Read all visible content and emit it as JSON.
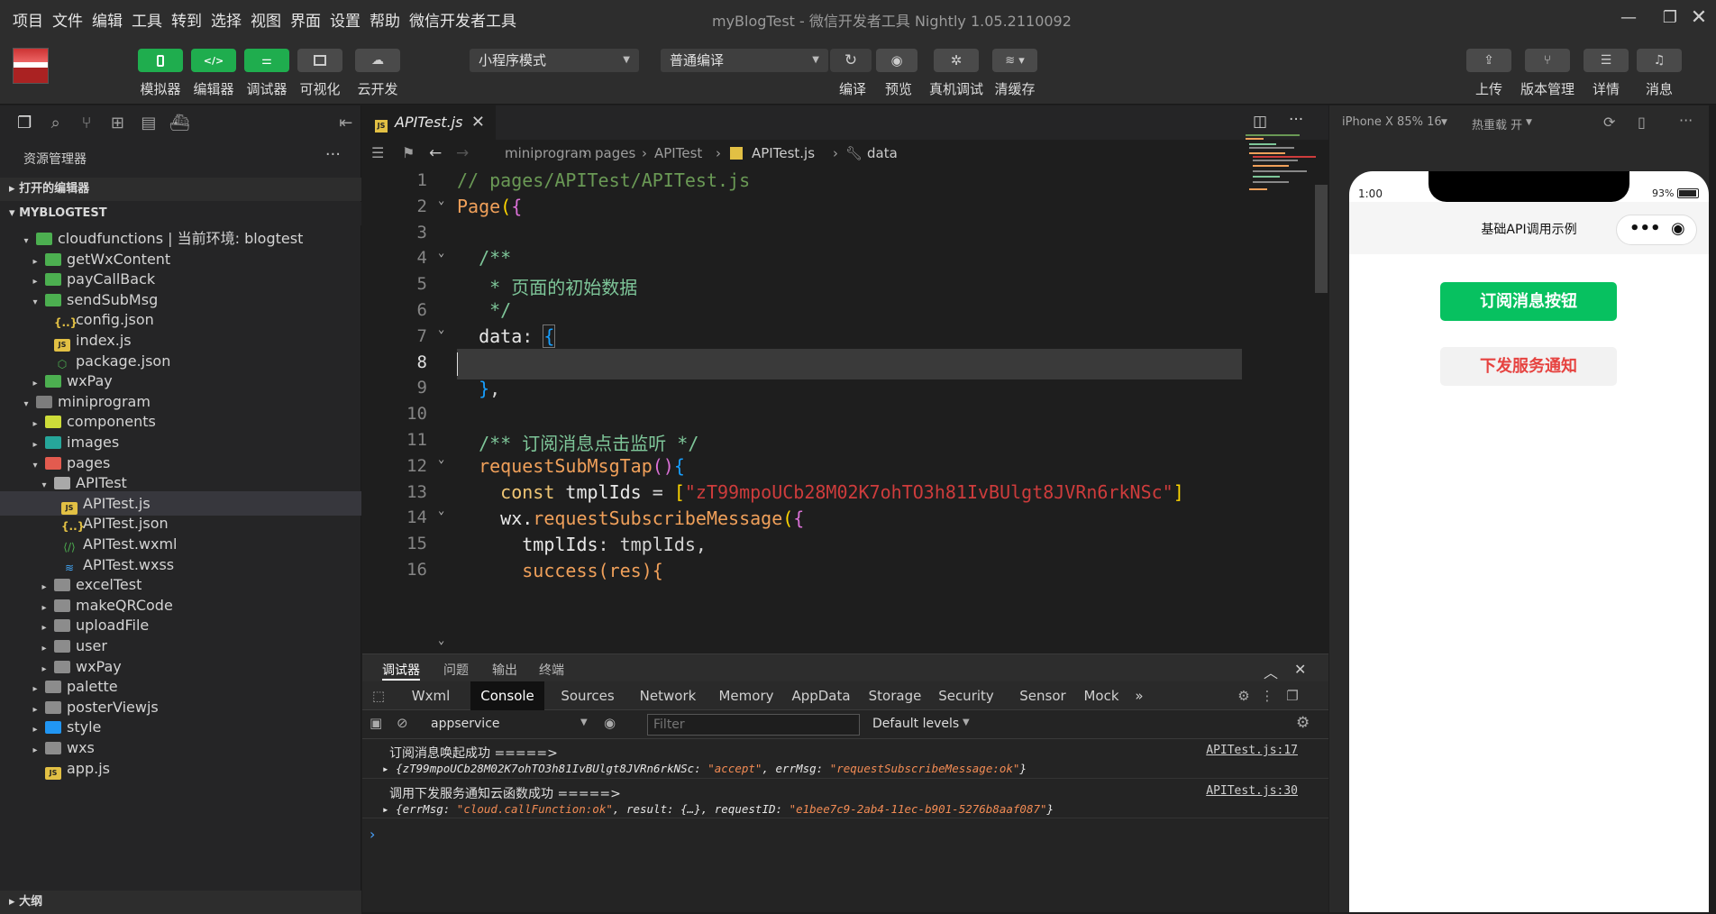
{
  "menu": [
    "项目",
    "文件",
    "编辑",
    "工具",
    "转到",
    "选择",
    "视图",
    "界面",
    "设置",
    "帮助",
    "微信开发者工具"
  ],
  "window_title": "myBlogTest - 微信开发者工具 Nightly 1.05.2110092",
  "toolbar": {
    "left_buttons": [
      "模拟器",
      "编辑器",
      "调试器",
      "可视化",
      "云开发"
    ],
    "mode_select": "小程序模式",
    "compile_select": "普通编译",
    "mid_buttons": [
      "编译",
      "预览",
      "真机调试",
      "清缓存"
    ],
    "right_buttons": [
      "上传",
      "版本管理",
      "详情",
      "消息"
    ]
  },
  "explorer": {
    "title": "资源管理器",
    "open_editors": "打开的编辑器",
    "project": "MYBLOGTEST",
    "outline": "大纲",
    "items": [
      {
        "label": "cloudfunctions | 当前环境: blogtest",
        "depth": 1,
        "kind": "fcloud",
        "arrow": "open"
      },
      {
        "label": "getWxContent",
        "depth": 2,
        "kind": "fcloud",
        "arrow": "closed"
      },
      {
        "label": "payCallBack",
        "depth": 2,
        "kind": "fcloud",
        "arrow": "closed"
      },
      {
        "label": "sendSubMsg",
        "depth": 2,
        "kind": "fcloud",
        "arrow": "open"
      },
      {
        "label": "config.json",
        "depth": 3,
        "kind": "json",
        "arrow": "none"
      },
      {
        "label": "index.js",
        "depth": 3,
        "kind": "js",
        "arrow": "none"
      },
      {
        "label": "package.json",
        "depth": 3,
        "kind": "pkg",
        "arrow": "none"
      },
      {
        "label": "wxPay",
        "depth": 2,
        "kind": "fcloud",
        "arrow": "closed"
      },
      {
        "label": "miniprogram",
        "depth": 1,
        "kind": "fmini",
        "arrow": "open"
      },
      {
        "label": "components",
        "depth": 2,
        "kind": "fcomp",
        "arrow": "closed"
      },
      {
        "label": "images",
        "depth": 2,
        "kind": "fimg",
        "arrow": "closed"
      },
      {
        "label": "pages",
        "depth": 2,
        "kind": "fpage",
        "arrow": "open"
      },
      {
        "label": "APITest",
        "depth": 3,
        "kind": "fold open",
        "arrow": "open"
      },
      {
        "label": "APITest.js",
        "depth": 4,
        "kind": "js",
        "arrow": "none",
        "selected": true
      },
      {
        "label": "APITest.json",
        "depth": 4,
        "kind": "json",
        "arrow": "none"
      },
      {
        "label": "APITest.wxml",
        "depth": 4,
        "kind": "wxml",
        "arrow": "none"
      },
      {
        "label": "APITest.wxss",
        "depth": 4,
        "kind": "wxss",
        "arrow": "none"
      },
      {
        "label": "excelTest",
        "depth": 3,
        "kind": "fold",
        "arrow": "closed"
      },
      {
        "label": "makeQRCode",
        "depth": 3,
        "kind": "fold",
        "arrow": "closed"
      },
      {
        "label": "uploadFile",
        "depth": 3,
        "kind": "fold",
        "arrow": "closed"
      },
      {
        "label": "user",
        "depth": 3,
        "kind": "fold",
        "arrow": "closed"
      },
      {
        "label": "wxPay",
        "depth": 3,
        "kind": "fold",
        "arrow": "closed"
      },
      {
        "label": "palette",
        "depth": 2,
        "kind": "fold",
        "arrow": "closed"
      },
      {
        "label": "posterViewjs",
        "depth": 2,
        "kind": "fold",
        "arrow": "closed"
      },
      {
        "label": "style",
        "depth": 2,
        "kind": "fstyle",
        "arrow": "closed"
      },
      {
        "label": "wxs",
        "depth": 2,
        "kind": "fold",
        "arrow": "closed"
      },
      {
        "label": "app.js",
        "depth": 2,
        "kind": "js",
        "arrow": "none"
      }
    ]
  },
  "editor": {
    "tab": "APITest.js",
    "breadcrumb": [
      "miniprogram",
      "pages",
      "APITest",
      "APITest.js",
      "data"
    ],
    "lines": [
      "1",
      "2",
      "3",
      "4",
      "5",
      "6",
      "7",
      "8",
      "9",
      "10",
      "11",
      "12",
      "13",
      "14",
      "15",
      "16"
    ],
    "code": {
      "l1": "// pages/APITest/APITest.js",
      "l2a": "Page",
      "l2b": "(",
      "l2c": "{",
      "l4": "  /**",
      "l5": "   * 页面的初始数据",
      "l6": "   */",
      "l7a": "  data",
      "l7b": ": ",
      "l7c": "{",
      "l9a": "  }",
      "l9b": ",",
      "l11": "  /** 订阅消息点击监听 */",
      "l12a": "  requestSubMsgTap",
      "l12b": "()",
      "l12c": "{",
      "l13a": "    const",
      "l13b": " tmplIds",
      "l13c": " = ",
      "l13d": "[",
      "l13e": "\"zT99mpoUCb28M02K7ohTO3h81IvBUlgt8JVRn6rkNSc\"",
      "l13f": "]",
      "l14a": "    wx.",
      "l14b": "requestSubscribeMessage",
      "l14c": "(",
      "l14d": "{",
      "l15a": "      tmplIds",
      "l15b": ": tmplIds,",
      "l16": "      success(res){"
    }
  },
  "debugger": {
    "tabs": [
      "调试器",
      "问题",
      "输出",
      "终端"
    ],
    "devtools_tabs": [
      "Wxml",
      "Console",
      "Sources",
      "Network",
      "Memory",
      "AppData",
      "Storage",
      "Security",
      "Sensor",
      "Mock"
    ],
    "active_tab": "Console",
    "context": "appservice",
    "filter_placeholder": "Filter",
    "levels": "Default levels",
    "logs": [
      {
        "text": "订阅消息唤起成功 =====>",
        "source": "APITest.js:17",
        "obj_pre": "{zT99mpoUCb28M02K7ohTO3h81IvBUlgt8JVRn6rkNSc: ",
        "obj_v1": "\"accept\"",
        "obj_mid": ", errMsg: ",
        "obj_v2": "\"requestSubscribeMessage:ok\"",
        "obj_end": "}"
      },
      {
        "text": "调用下发服务通知云函数成功 =====>",
        "source": "APITest.js:30",
        "obj_pre": "{errMsg: ",
        "obj_v1": "\"cloud.callFunction:ok\"",
        "obj_mid": ", result: {…}, requestID: ",
        "obj_v2": "\"e1bee7c9-2ab4-11ec-b901-5276b8aaf087\"",
        "obj_end": "}"
      }
    ],
    "prompt": "›"
  },
  "simulator": {
    "device": "iPhone X 85% 16",
    "hot_reload": "热重载 开",
    "time": "1:00",
    "battery": "93%",
    "page_title": "基础API调用示例",
    "btn_subscribe": "订阅消息按钮",
    "btn_notify": "下发服务通知"
  },
  "colors": {
    "accent_green": "#07c160",
    "danger_red": "#e64340"
  }
}
